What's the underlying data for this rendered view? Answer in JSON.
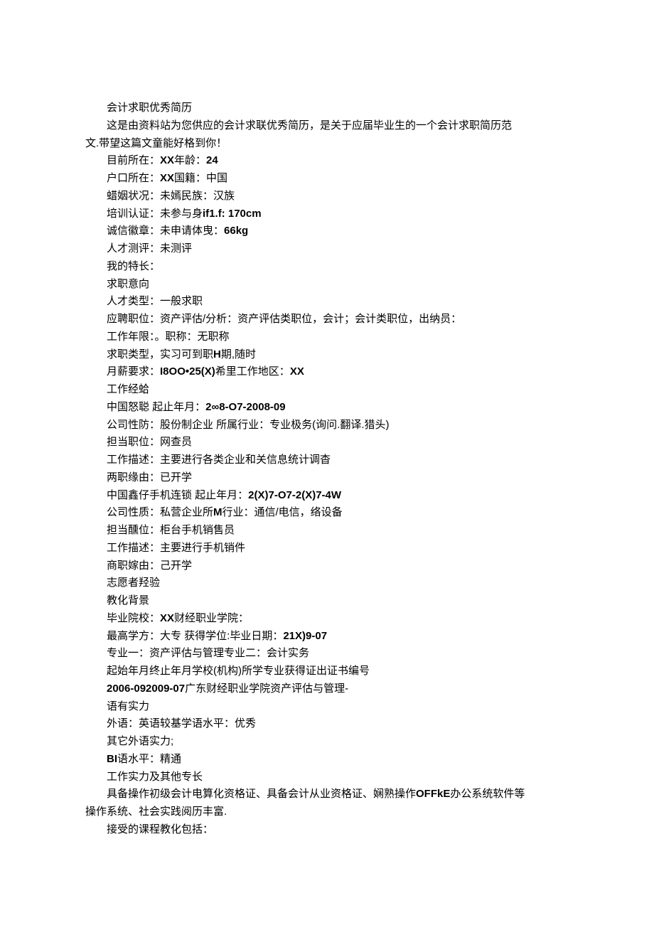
{
  "lines": [
    {
      "segs": [
        {
          "t": "会计求职优秀简历",
          "b": false
        }
      ]
    },
    {
      "segs": [
        {
          "t": "这是由资料站为您供应的会计求联优秀简历，是关于应届毕业生的一个会计求职简历范",
          "b": false
        }
      ],
      "full": true
    },
    {
      "segs": [
        {
          "t": "文.带望这篇文童能好格到你！",
          "b": false
        }
      ],
      "noindent": true
    },
    {
      "segs": [
        {
          "t": "目前所在：",
          "b": false
        },
        {
          "t": "XX",
          "b": true
        },
        {
          "t": "年龄：",
          "b": false
        },
        {
          "t": "24",
          "b": true
        }
      ]
    },
    {
      "segs": [
        {
          "t": "户口所在：",
          "b": false
        },
        {
          "t": "XX",
          "b": true
        },
        {
          "t": "国籍：中国",
          "b": false
        }
      ]
    },
    {
      "segs": [
        {
          "t": "蜡姻状况：未嫣民族：汉族",
          "b": false
        }
      ]
    },
    {
      "segs": [
        {
          "t": "培训认证：未参与身",
          "b": false
        },
        {
          "t": "if1.f:  170cm",
          "b": true
        }
      ]
    },
    {
      "segs": [
        {
          "t": "诚信徽章：未申请体曳：",
          "b": false
        },
        {
          "t": "66kg",
          "b": true
        }
      ]
    },
    {
      "segs": [
        {
          "t": "人才测评：未测评",
          "b": false
        }
      ]
    },
    {
      "segs": [
        {
          "t": "我的特长：",
          "b": false
        }
      ]
    },
    {
      "segs": [
        {
          "t": "求职意向",
          "b": false
        }
      ]
    },
    {
      "segs": [
        {
          "t": "人才类型：一般求职",
          "b": false
        }
      ]
    },
    {
      "segs": [
        {
          "t": "应聘职位：资产评估/分析：资产评估类职位，会计；会计类职位，出纳员：",
          "b": false
        }
      ]
    },
    {
      "segs": [
        {
          "t": "工作年限：。职称：无职称",
          "b": false
        }
      ]
    },
    {
      "segs": [
        {
          "t": "求职类型，实习可到职",
          "b": false
        },
        {
          "t": "H",
          "b": true
        },
        {
          "t": "期,随时",
          "b": false
        }
      ]
    },
    {
      "segs": [
        {
          "t": "月薪要求：",
          "b": false
        },
        {
          "t": "I8OO•25(X)",
          "b": true
        },
        {
          "t": "希里工作地区：",
          "b": false
        },
        {
          "t": "XX",
          "b": true
        }
      ]
    },
    {
      "segs": [
        {
          "t": "工作经蛤",
          "b": false
        }
      ]
    },
    {
      "segs": [
        {
          "t": "中国怒聪     起止年月：",
          "b": false
        },
        {
          "t": "2∞8-O7-2008-09",
          "b": true
        }
      ]
    },
    {
      "segs": [
        {
          "t": "公司性防：股份制企业       所属行业：专业极务(询问.翻译.猎头)",
          "b": false
        }
      ]
    },
    {
      "segs": [
        {
          "t": "担当职位：网查员",
          "b": false
        }
      ]
    },
    {
      "segs": [
        {
          "t": "工作描述：主要进行各类企业和关信息统计调杳",
          "b": false
        }
      ]
    },
    {
      "segs": [
        {
          "t": "两职缘由：已开学",
          "b": false
        }
      ]
    },
    {
      "segs": [
        {
          "t": "中国鑫仔手机连锁     起止年月：",
          "b": false
        },
        {
          "t": "2(X)7-O7-2(X)7-4W",
          "b": true
        }
      ]
    },
    {
      "segs": [
        {
          "t": "公司性质：私营企业所",
          "b": false
        },
        {
          "t": "M",
          "b": true
        },
        {
          "t": "行业：通信/电信，络设备",
          "b": false
        }
      ]
    },
    {
      "segs": [
        {
          "t": "担当醺位：柜台手机销售员",
          "b": false
        }
      ]
    },
    {
      "segs": [
        {
          "t": "工作描述：主要进行手机销件",
          "b": false
        }
      ]
    },
    {
      "segs": [
        {
          "t": "商职嫁由：己开学",
          "b": false
        }
      ]
    },
    {
      "segs": [
        {
          "t": "志愿者羟验",
          "b": false
        }
      ]
    },
    {
      "segs": [
        {
          "t": "教化背景",
          "b": false
        }
      ]
    },
    {
      "segs": [
        {
          "t": "毕业院校：",
          "b": false
        },
        {
          "t": "XX",
          "b": true
        },
        {
          "t": "财经职业学院：",
          "b": false
        }
      ]
    },
    {
      "segs": [
        {
          "t": "最高学方：大专       获得学位:毕业日期：",
          "b": false
        },
        {
          "t": "21X)9-07",
          "b": true
        }
      ]
    },
    {
      "segs": [
        {
          "t": "专业一：资产评估与管理专业二：会计实务",
          "b": false
        }
      ]
    },
    {
      "segs": [
        {
          "t": "起始年月终止年月学校(机构)所学专业获得证出证书编号",
          "b": false
        }
      ]
    },
    {
      "segs": [
        {
          "t": "2006-092009-07",
          "b": true
        },
        {
          "t": "广东财经职业学院资产评估与管理-",
          "b": false
        }
      ]
    },
    {
      "segs": [
        {
          "t": "语有实力",
          "b": false
        }
      ]
    },
    {
      "segs": [
        {
          "t": "外语：英语较基学语水平：优秀",
          "b": false
        }
      ]
    },
    {
      "segs": [
        {
          "t": "其它外语实力;",
          "b": false
        }
      ]
    },
    {
      "segs": [
        {
          "t": "BI",
          "b": true
        },
        {
          "t": "语水平：精通",
          "b": false
        }
      ]
    },
    {
      "segs": [
        {
          "t": "工作实力及其他专长",
          "b": false
        }
      ]
    },
    {
      "segs": [
        {
          "t": "具备操作初级会计电算化资格证、具备会计从业资格证、娴熟操作",
          "b": false
        },
        {
          "t": "OFFkE",
          "b": true
        },
        {
          "t": "办公系统软件等",
          "b": false
        }
      ],
      "full": true
    },
    {
      "segs": [
        {
          "t": "操作系统、社会实践阅历丰富.",
          "b": false
        }
      ],
      "noindent": true
    },
    {
      "segs": [
        {
          "t": "接受的课程教化包括：",
          "b": false
        }
      ]
    }
  ]
}
